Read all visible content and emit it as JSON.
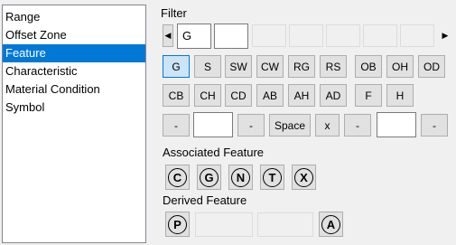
{
  "list": {
    "items": [
      "Range",
      "Offset Zone",
      "Feature",
      "Characteristic",
      "Material Condition",
      "Symbol"
    ],
    "selected": "Feature"
  },
  "filter": {
    "label": "Filter",
    "value": "G",
    "row1": [
      "G",
      "S",
      "SW",
      "CW",
      "RG",
      "RS",
      "OB",
      "OH",
      "OD"
    ],
    "row2": [
      "CB",
      "CH",
      "CD",
      "AB",
      "AH",
      "AD",
      "F",
      "H"
    ],
    "row3": {
      "minus": "-",
      "space": "Space",
      "x": "x"
    }
  },
  "associated": {
    "label": "Associated Feature",
    "symbols": [
      "C",
      "G",
      "N",
      "T",
      "X"
    ]
  },
  "derived": {
    "label": "Derived Feature",
    "symbols": [
      "P",
      "A"
    ]
  }
}
